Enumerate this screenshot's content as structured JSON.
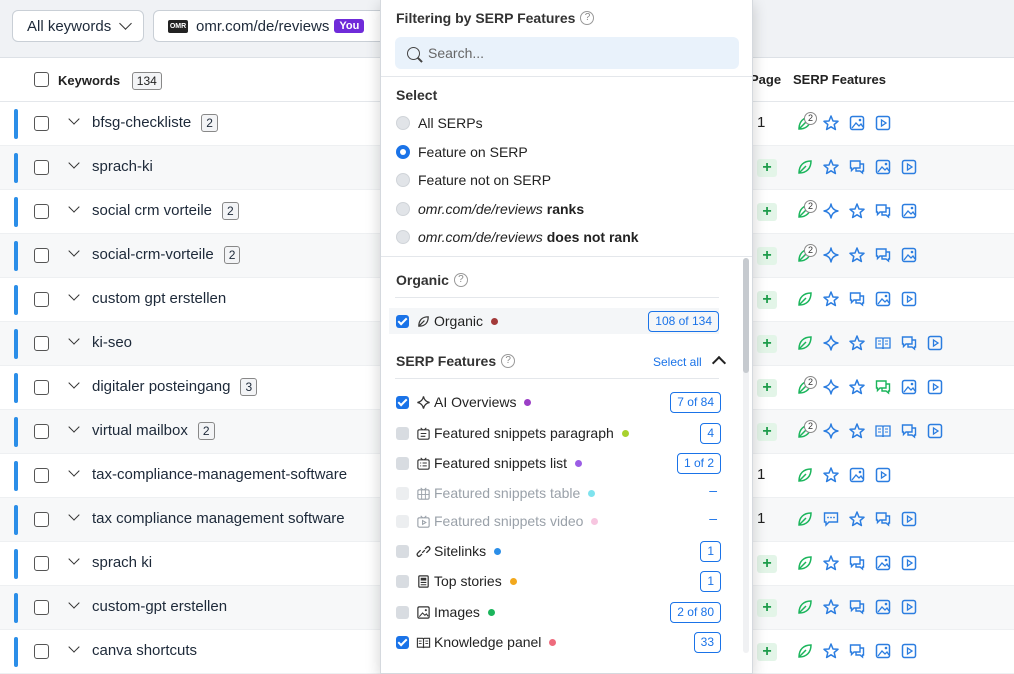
{
  "toolbar": {
    "keywords_dropdown": "All keywords",
    "domain_logo": "OMR",
    "domain_dropdown": "omr.com/de/reviews",
    "you_badge": "You"
  },
  "table": {
    "header": {
      "keywords": "Keywords",
      "count": "134",
      "page": "Page",
      "serp": "SERP Features"
    },
    "rows": [
      {
        "keyword": "bfsg-checkliste",
        "count": "2",
        "page": "1",
        "icons": [
          "leaf-icon-2",
          "star-icon",
          "image-icon",
          "video-icon"
        ]
      },
      {
        "keyword": "sprach-ki",
        "count": "",
        "page": "+",
        "icons": [
          "leaf-icon",
          "star-icon",
          "chat-icon",
          "image-icon",
          "video-icon"
        ]
      },
      {
        "keyword": "social crm vorteile",
        "count": "2",
        "page": "+",
        "icons": [
          "leaf-icon-2",
          "sparkle-icon",
          "star-icon",
          "chat-icon",
          "image-icon"
        ]
      },
      {
        "keyword": "social-crm-vorteile",
        "count": "2",
        "page": "+",
        "icons": [
          "leaf-icon-2",
          "sparkle-icon",
          "star-icon",
          "chat-icon",
          "image-icon"
        ]
      },
      {
        "keyword": "custom gpt erstellen",
        "count": "",
        "page": "+",
        "icons": [
          "leaf-icon",
          "star-icon",
          "chat-icon",
          "image-icon",
          "video-icon"
        ]
      },
      {
        "keyword": "ki-seo",
        "count": "",
        "page": "+",
        "icons": [
          "leaf-icon",
          "sparkle-icon",
          "star-icon",
          "book-icon",
          "chat-icon",
          "video-icon"
        ]
      },
      {
        "keyword": "digitaler posteingang",
        "count": "3",
        "page": "+",
        "icons": [
          "leaf-icon-2",
          "sparkle-icon",
          "star-icon",
          "chat-green-icon",
          "image-icon",
          "video-icon"
        ]
      },
      {
        "keyword": "virtual mailbox",
        "count": "2",
        "page": "+",
        "icons": [
          "leaf-icon-2",
          "sparkle-icon",
          "star-icon",
          "book-icon",
          "chat-icon",
          "video-icon"
        ]
      },
      {
        "keyword": "tax-compliance-management-software",
        "count": "",
        "page": "1",
        "icons": [
          "leaf-icon",
          "star-icon",
          "image-icon",
          "video-icon"
        ]
      },
      {
        "keyword": "tax compliance management software",
        "count": "",
        "page": "1",
        "icons": [
          "leaf-icon",
          "comment-icon",
          "star-icon",
          "chat-icon",
          "video-icon"
        ]
      },
      {
        "keyword": "sprach ki",
        "count": "",
        "page": "+",
        "icons": [
          "leaf-icon",
          "star-icon",
          "chat-icon",
          "image-icon",
          "video-icon"
        ]
      },
      {
        "keyword": "custom-gpt erstellen",
        "count": "",
        "page": "+",
        "icons": [
          "leaf-icon",
          "star-icon",
          "chat-icon",
          "image-icon",
          "video-icon"
        ]
      },
      {
        "keyword": "canva shortcuts",
        "count": "",
        "page": "+",
        "icons": [
          "leaf-icon",
          "star-icon",
          "chat-icon",
          "image-icon",
          "video-icon"
        ]
      }
    ]
  },
  "panel": {
    "title": "Filtering by SERP Features",
    "search_placeholder": "Search...",
    "select_heading": "Select",
    "options": [
      {
        "label": "All SERPs",
        "selected": false
      },
      {
        "label": "Feature on SERP",
        "selected": true
      },
      {
        "label": "Feature not on SERP",
        "selected": false
      }
    ],
    "rank_domain": "omr.com/de/reviews",
    "ranks_label": "ranks",
    "not_rank_label": "does not rank",
    "organic_heading": "Organic",
    "organic_item": {
      "label": "Organic",
      "count": "108 of 134",
      "color": "#a33a3a"
    },
    "serp_heading": "SERP Features",
    "select_all": "Select all",
    "features": [
      {
        "label": "AI Overviews",
        "count": "7 of 84",
        "color": "#9b3fc6",
        "state": "on",
        "icon": "sparkle-icon"
      },
      {
        "label": "Featured snippets paragraph",
        "count": "4",
        "color": "#a8d12e",
        "state": "off",
        "icon": "snippet-paragraph-icon"
      },
      {
        "label": "Featured snippets list",
        "count": "1 of 2",
        "color": "#9b5de5",
        "state": "off",
        "icon": "snippet-list-icon"
      },
      {
        "label": "Featured snippets table",
        "count": "–",
        "color": "#7fe3ee",
        "state": "dis",
        "icon": "snippet-table-icon"
      },
      {
        "label": "Featured snippets video",
        "count": "–",
        "color": "#f7c6e0",
        "state": "dis",
        "icon": "snippet-video-icon"
      },
      {
        "label": "Sitelinks",
        "count": "1",
        "color": "#2b8ee8",
        "state": "off",
        "icon": "link-icon"
      },
      {
        "label": "Top stories",
        "count": "1",
        "color": "#f2a81d",
        "state": "off",
        "icon": "news-icon"
      },
      {
        "label": "Images",
        "count": "2 of 80",
        "color": "#1bb55c",
        "state": "off",
        "icon": "image-icon"
      },
      {
        "label": "Knowledge panel",
        "count": "33",
        "color": "#ee6b7d",
        "state": "on",
        "icon": "book-icon"
      }
    ]
  }
}
